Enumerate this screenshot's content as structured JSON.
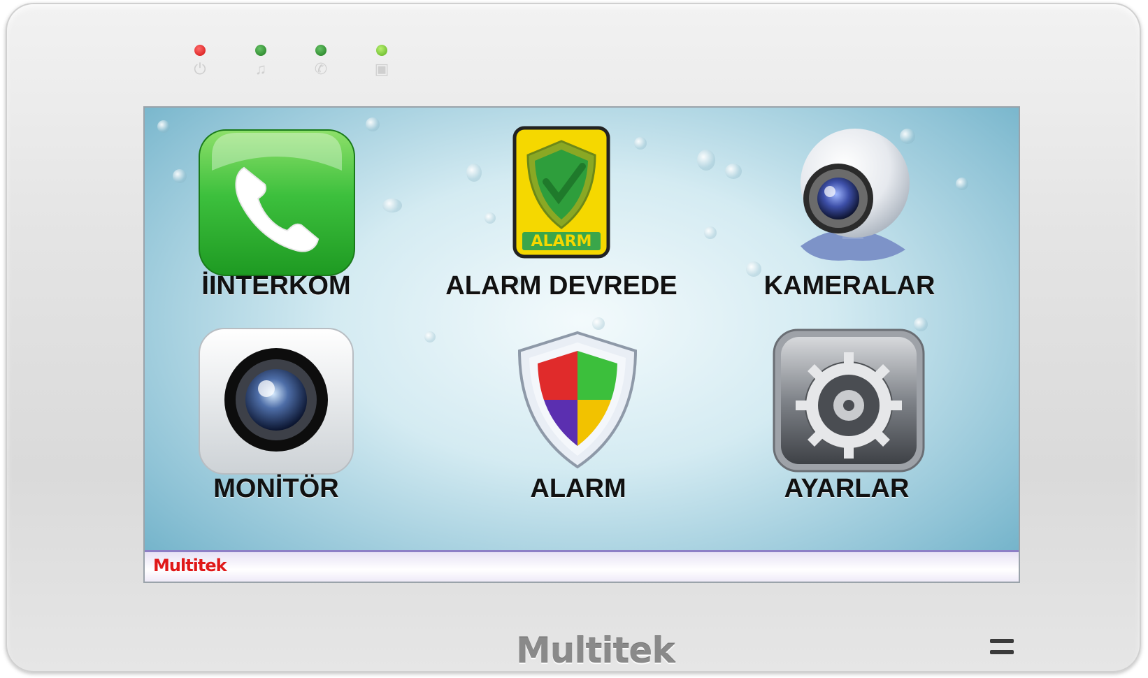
{
  "device": {
    "brand": "Multitek",
    "indicators": [
      {
        "icon": "power-icon",
        "color": "#e02020"
      },
      {
        "icon": "bell-icon",
        "color": "#2a8a2a"
      },
      {
        "icon": "phone-icon",
        "color": "#2a8a2a"
      },
      {
        "icon": "door-icon",
        "color": "#6fc630"
      }
    ]
  },
  "screen": {
    "apps": [
      {
        "label": "İINTERKOM",
        "icon": "phone-icon"
      },
      {
        "label": "ALARM DEVREDE",
        "icon": "alarm-shield-icon",
        "badge": "ALARM"
      },
      {
        "label": "KAMERALAR",
        "icon": "webcam-icon"
      },
      {
        "label": "MONİTÖR",
        "icon": "camera-lens-icon"
      },
      {
        "label": "ALARM",
        "icon": "security-shield-icon"
      },
      {
        "label": "AYARLAR",
        "icon": "settings-gear-icon"
      }
    ],
    "status_bar": {
      "brand": "Multitek"
    }
  },
  "colors": {
    "accent_green": "#2eb82e",
    "alarm_yellow": "#f5d800",
    "status_border": "#8d7fc6",
    "brand_red": "#e01818"
  }
}
